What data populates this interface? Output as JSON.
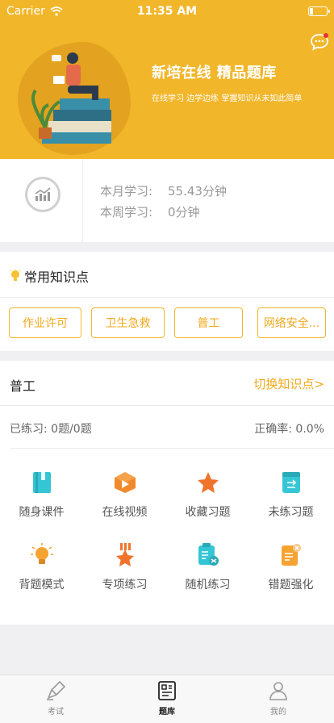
{
  "status": {
    "carrier": "Carrier",
    "time": "11:35 AM"
  },
  "hero": {
    "title": "新培在线 精品题库",
    "subtitle": "在线学习   边学边练   掌握知识从未如此简单"
  },
  "stats": {
    "month_label": "本月学习:",
    "month_value": "55.43分钟",
    "week_label": "本周学习:",
    "week_value": "0分钟"
  },
  "knowledge": {
    "title": "常用知识点",
    "items": [
      "作业许可",
      "卫生急救",
      "普工",
      "网络安全..."
    ]
  },
  "main": {
    "title": "普工",
    "switch_label": "切换知识点>",
    "progress": "已练习: 0题/0题",
    "accuracy": "正确率: 0.0%",
    "grid": [
      {
        "label": "随身课件",
        "icon": "book-icon",
        "color": "#35c6d6"
      },
      {
        "label": "在线视频",
        "icon": "video-box-icon",
        "color": "#f08a2d"
      },
      {
        "label": "收藏习题",
        "icon": "star-icon",
        "color": "#f0732b"
      },
      {
        "label": "未练习题",
        "icon": "list-card-icon",
        "color": "#35c6d6"
      },
      {
        "label": "背题模式",
        "icon": "lightbulb-icon",
        "color": "#f5a331"
      },
      {
        "label": "专项练习",
        "icon": "medal-star-icon",
        "color": "#f0732b"
      },
      {
        "label": "随机练习",
        "icon": "shuffle-clipboard-icon",
        "color": "#35c6d6"
      },
      {
        "label": "错题强化",
        "icon": "error-doc-icon",
        "color": "#f5a331"
      }
    ]
  },
  "tabbar": {
    "tabs": [
      "考试",
      "题库",
      "我的"
    ],
    "active": 1
  },
  "colors": {
    "accent": "#f1b62a",
    "accent_text": "#f1a91e",
    "teal": "#35c6d6",
    "orange": "#f0732b"
  }
}
